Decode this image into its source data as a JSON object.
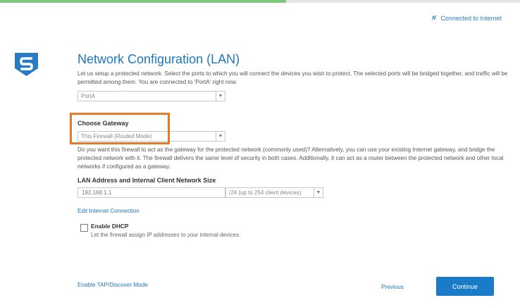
{
  "progress": {
    "fraction": 0.55,
    "color": "#7fc97f"
  },
  "status": {
    "label": "Connected to Internet",
    "icon": "plug-icon"
  },
  "logo": {
    "letter": "S",
    "color": "#2a7bc5"
  },
  "title": "Network Configuration (LAN)",
  "description": "Let us setup a protected network. Select the ports to which you will connect the devices you wish to protect. The selected ports will be bridged together, and traffic will be permitted among them. You are connected to 'PortA' right now.",
  "port_select": {
    "value": "PortA"
  },
  "gateway": {
    "heading": "Choose Gateway",
    "value": "This Firewall (Routed Mode)",
    "description": "Do you want this firewall to act as the gateway for the protected network (commonly used)? Alternatively, you can use your existing Internet gateway, and bridge the protected network with it. The firewall delivers the same level of security in both cases. Additionally, it can act as a router between the protected network and other local networks if configured as a gateway."
  },
  "lan": {
    "heading": "LAN Address and Internal Client Network Size",
    "address": "192.168.1.1",
    "subnet": "/24 (up to 254 client devices)"
  },
  "links": {
    "edit_internet": "Edit Internet Connection",
    "tap_mode": "Enable TAP/Discover Mode"
  },
  "dhcp": {
    "label": "Enable DHCP",
    "description": "Let the firewall assign IP addresses to your internal devices.",
    "checked": false
  },
  "nav": {
    "previous": "Previous",
    "continue": "Continue"
  },
  "colors": {
    "accent": "#1d76bc",
    "highlight": "#e07b2a"
  }
}
